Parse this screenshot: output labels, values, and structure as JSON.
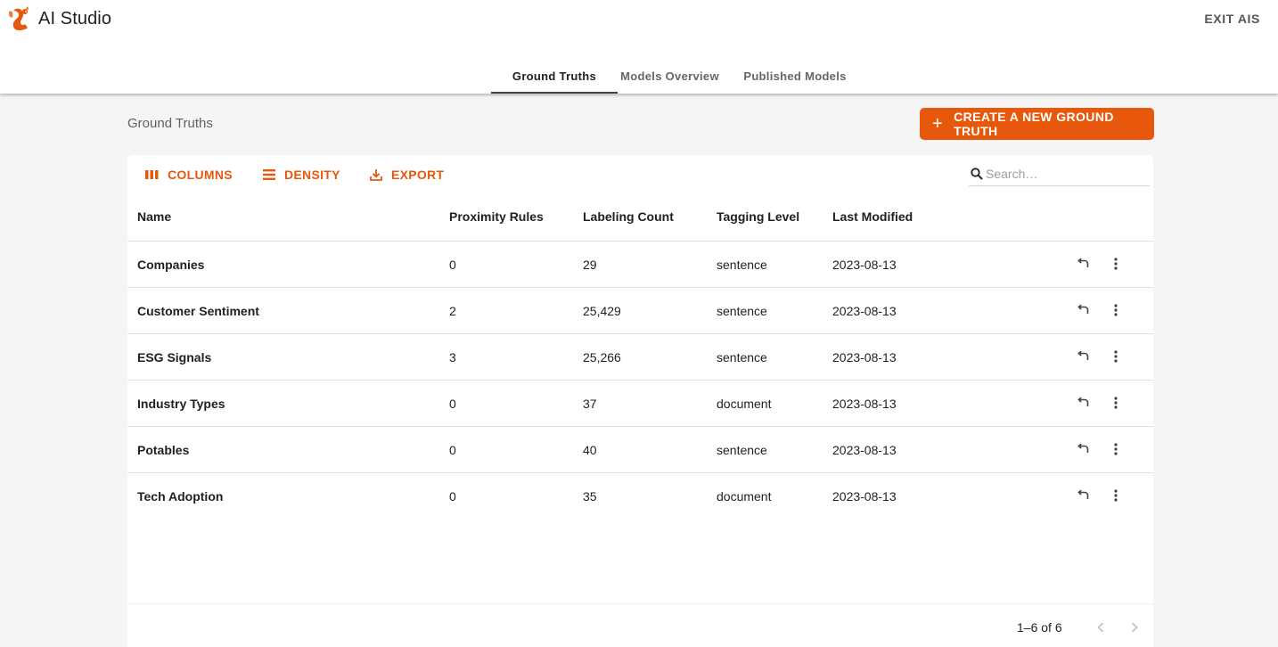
{
  "app": {
    "title": "AI Studio",
    "exit_label": "EXIT AIS"
  },
  "tabs": [
    {
      "label": "Ground Truths",
      "active": true
    },
    {
      "label": "Models Overview",
      "active": false
    },
    {
      "label": "Published Models",
      "active": false
    }
  ],
  "page": {
    "title": "Ground Truths",
    "create_label": "CREATE A NEW GROUND TRUTH"
  },
  "toolbar": {
    "columns_label": "COLUMNS",
    "density_label": "DENSITY",
    "export_label": "EXPORT",
    "search_placeholder": "Search…"
  },
  "table": {
    "headers": [
      "Name",
      "Proximity Rules",
      "Labeling Count",
      "Tagging Level",
      "Last Modified"
    ],
    "rows": [
      [
        "Companies",
        "0",
        "29",
        "sentence",
        "2023-08-13"
      ],
      [
        "Customer Sentiment",
        "2",
        "25,429",
        "sentence",
        "2023-08-13"
      ],
      [
        "ESG Signals",
        "3",
        "25,266",
        "sentence",
        "2023-08-13"
      ],
      [
        "Industry Types",
        "0",
        "37",
        "document",
        "2023-08-13"
      ],
      [
        "Potables",
        "0",
        "40",
        "sentence",
        "2023-08-13"
      ],
      [
        "Tech Adoption",
        "0",
        "35",
        "document",
        "2023-08-13"
      ]
    ]
  },
  "pagination": {
    "text": "1–6 of 6"
  },
  "colors": {
    "accent": "#e8580c",
    "text": "#212121",
    "muted": "#616161",
    "divider": "#e0e0e0",
    "background": "#f5f5f5"
  },
  "icons": {
    "logo": "squirrel-logo-icon",
    "create": "plus-icon",
    "columns": "columns-icon",
    "density": "density-icon",
    "export": "download-icon",
    "search": "search-icon",
    "row_action": "reply-icon",
    "row_menu": "more-vert-icon",
    "prev": "chevron-left-icon",
    "next": "chevron-right-icon"
  }
}
